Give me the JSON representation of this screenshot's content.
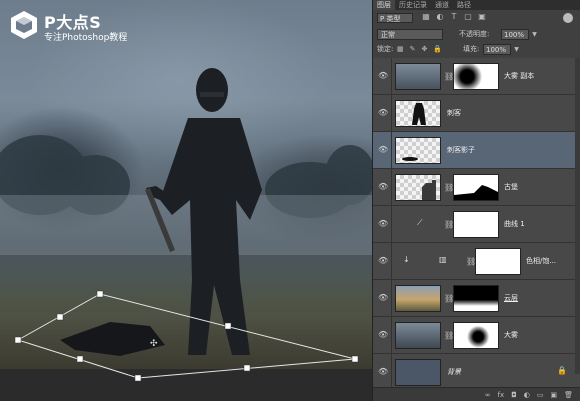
{
  "logo": {
    "brand": "P大点S",
    "sub": "专注Photoshop教程"
  },
  "panel": {
    "tabs": [
      "图层",
      "历史记录",
      "通道",
      "路径"
    ],
    "kind": "P 类型",
    "filter_icons": [
      "image-filter-icon",
      "adjustment-filter-icon",
      "type-filter-icon",
      "shape-filter-icon",
      "smart-object-filter-icon"
    ],
    "blend_mode": "正常",
    "opacity_label": "不透明度:",
    "opacity_value": "100%",
    "lock_label": "锁定:",
    "fill_label": "填充:",
    "fill_value": "100%",
    "layers": [
      {
        "name": "大雾 副本",
        "type": "image-with-mask",
        "visible": true,
        "selected": false
      },
      {
        "name": "刺客",
        "type": "image",
        "visible": true,
        "selected": false
      },
      {
        "name": "刺客影子",
        "type": "image",
        "visible": true,
        "selected": true
      },
      {
        "name": "古堡",
        "type": "image-with-mask",
        "visible": true,
        "selected": false
      },
      {
        "name": "曲线 1",
        "type": "adjustment-curves",
        "visible": true,
        "selected": false
      },
      {
        "name": "色相/饱...",
        "type": "adjustment-hue",
        "visible": true,
        "selected": false
      },
      {
        "name": "云层",
        "type": "image-with-mask",
        "visible": true,
        "selected": false
      },
      {
        "name": "大雾",
        "type": "image-with-mask",
        "visible": true,
        "selected": false
      },
      {
        "name": "背景",
        "type": "background",
        "visible": true,
        "selected": false,
        "locked": true
      }
    ],
    "bottom_icons": [
      "link-icon",
      "fx-icon",
      "mask-icon",
      "adjustment-icon",
      "group-icon",
      "new-layer-icon",
      "trash-icon"
    ],
    "bottom_glyphs": [
      "∞",
      "fx",
      "◘",
      "◐",
      "▭",
      "▣",
      "🗑"
    ]
  },
  "colors": {
    "panel_bg": "#404040",
    "selected_row": "#586676",
    "canvas_floor": "#2b2b2b"
  }
}
